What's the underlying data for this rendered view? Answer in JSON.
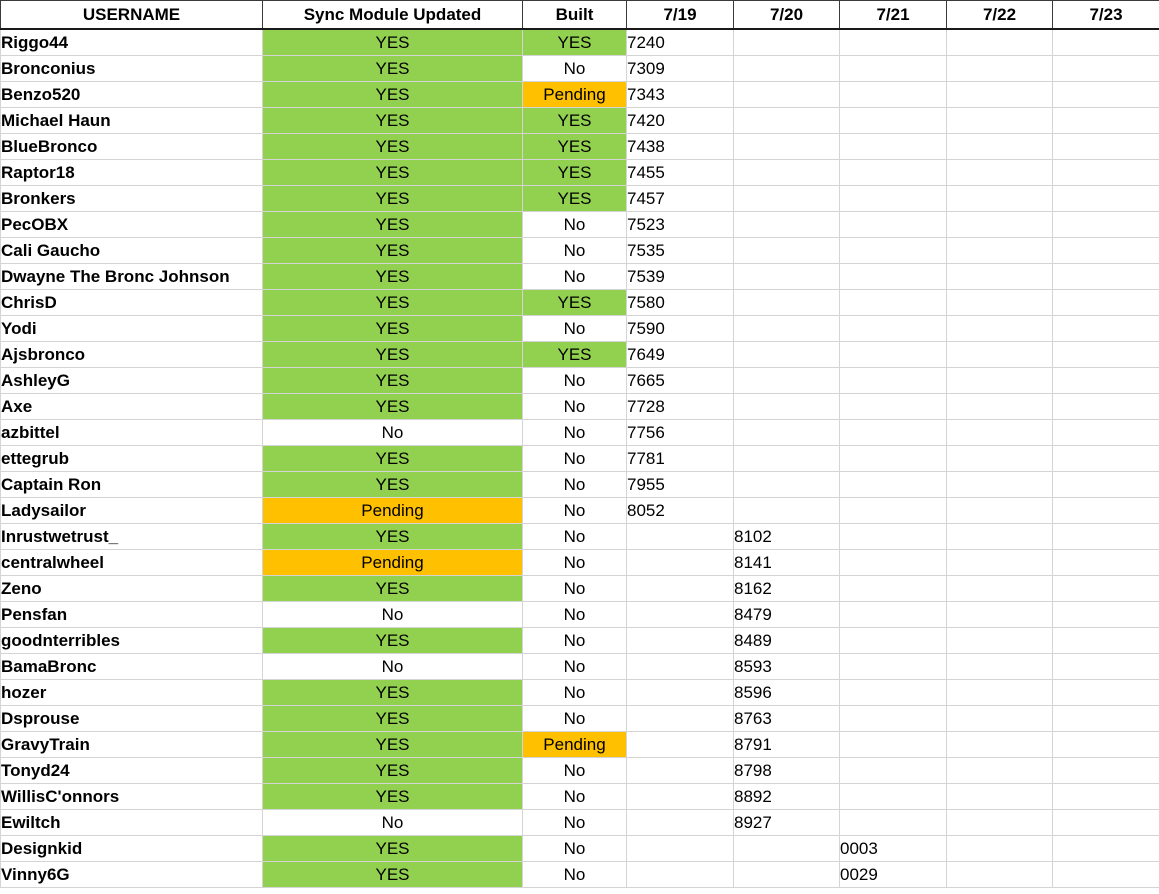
{
  "sheet": {
    "headers": [
      "USERNAME",
      "Sync Module Updated",
      "Built",
      "7/19",
      "7/20",
      "7/21",
      "7/22",
      "7/23"
    ],
    "rows": [
      {
        "user": "Riggo44",
        "sync": "YES",
        "built": "YES",
        "dates": [
          "7240",
          "",
          "",
          "",
          ""
        ]
      },
      {
        "user": "Bronconius",
        "sync": "YES",
        "built": "No",
        "dates": [
          "7309",
          "",
          "",
          "",
          ""
        ]
      },
      {
        "user": "Benzo520",
        "sync": "YES",
        "built": "Pending",
        "dates": [
          "7343",
          "",
          "",
          "",
          ""
        ]
      },
      {
        "user": "Michael Haun",
        "sync": "YES",
        "built": "YES",
        "dates": [
          "7420",
          "",
          "",
          "",
          ""
        ]
      },
      {
        "user": "BlueBronco",
        "sync": "YES",
        "built": "YES",
        "dates": [
          "7438",
          "",
          "",
          "",
          ""
        ]
      },
      {
        "user": "Raptor18",
        "sync": "YES",
        "built": "YES",
        "dates": [
          "7455",
          "",
          "",
          "",
          ""
        ]
      },
      {
        "user": "Bronkers",
        "sync": "YES",
        "built": "YES",
        "dates": [
          "7457",
          "",
          "",
          "",
          ""
        ]
      },
      {
        "user": "PecOBX",
        "sync": "YES",
        "built": "No",
        "dates": [
          "7523",
          "",
          "",
          "",
          ""
        ]
      },
      {
        "user": "Cali Gaucho",
        "sync": "YES",
        "built": "No",
        "dates": [
          "7535",
          "",
          "",
          "",
          ""
        ]
      },
      {
        "user": "Dwayne The Bronc Johnson",
        "sync": "YES",
        "built": "No",
        "dates": [
          "7539",
          "",
          "",
          "",
          ""
        ]
      },
      {
        "user": "ChrisD",
        "sync": "YES",
        "built": "YES",
        "dates": [
          "7580",
          "",
          "",
          "",
          ""
        ]
      },
      {
        "user": "Yodi",
        "sync": "YES",
        "built": "No",
        "dates": [
          "7590",
          "",
          "",
          "",
          ""
        ]
      },
      {
        "user": "Ajsbronco",
        "sync": "YES",
        "built": "YES",
        "dates": [
          "7649",
          "",
          "",
          "",
          ""
        ]
      },
      {
        "user": "AshleyG",
        "sync": "YES",
        "built": "No",
        "dates": [
          "7665",
          "",
          "",
          "",
          ""
        ]
      },
      {
        "user": "Axe",
        "sync": "YES",
        "built": "No",
        "dates": [
          "7728",
          "",
          "",
          "",
          ""
        ]
      },
      {
        "user": "azbittel",
        "sync": "No",
        "built": "No",
        "dates": [
          "7756",
          "",
          "",
          "",
          ""
        ]
      },
      {
        "user": "ettegrub",
        "sync": "YES",
        "built": "No",
        "dates": [
          "7781",
          "",
          "",
          "",
          ""
        ]
      },
      {
        "user": "Captain Ron",
        "sync": "YES",
        "built": "No",
        "dates": [
          "7955",
          "",
          "",
          "",
          ""
        ]
      },
      {
        "user": "Ladysailor",
        "sync": "Pending",
        "built": "No",
        "dates": [
          "8052",
          "",
          "",
          "",
          ""
        ]
      },
      {
        "user": "Inrustwetrust_",
        "sync": "YES",
        "built": "No",
        "dates": [
          "",
          "8102",
          "",
          "",
          ""
        ]
      },
      {
        "user": "centralwheel",
        "sync": "Pending",
        "built": "No",
        "dates": [
          "",
          "8141",
          "",
          "",
          ""
        ]
      },
      {
        "user": "Zeno",
        "sync": "YES",
        "built": "No",
        "dates": [
          "",
          "8162",
          "",
          "",
          ""
        ]
      },
      {
        "user": "Pensfan",
        "sync": "No",
        "built": "No",
        "dates": [
          "",
          "8479",
          "",
          "",
          ""
        ]
      },
      {
        "user": "goodnterribles",
        "sync": "YES",
        "built": "No",
        "dates": [
          "",
          "8489",
          "",
          "",
          ""
        ]
      },
      {
        "user": "BamaBronc",
        "sync": "No",
        "built": "No",
        "dates": [
          "",
          "8593",
          "",
          "",
          ""
        ]
      },
      {
        "user": "hozer",
        "sync": "YES",
        "built": "No",
        "dates": [
          "",
          "8596",
          "",
          "",
          ""
        ]
      },
      {
        "user": "Dsprouse",
        "sync": "YES",
        "built": "No",
        "dates": [
          "",
          "8763",
          "",
          "",
          ""
        ]
      },
      {
        "user": "GravyTrain",
        "sync": "YES",
        "built": "Pending",
        "dates": [
          "",
          "8791",
          "",
          "",
          ""
        ]
      },
      {
        "user": "Tonyd24",
        "sync": "YES",
        "built": "No",
        "dates": [
          "",
          "8798",
          "",
          "",
          ""
        ]
      },
      {
        "user": "WillisC'onnors",
        "sync": "YES",
        "built": "No",
        "dates": [
          "",
          "8892",
          "",
          "",
          ""
        ]
      },
      {
        "user": "Ewiltch",
        "sync": "No",
        "built": "No",
        "dates": [
          "",
          "8927",
          "",
          "",
          ""
        ]
      },
      {
        "user": "Designkid",
        "sync": "YES",
        "built": "No",
        "dates": [
          "",
          "",
          "0003",
          "",
          ""
        ]
      },
      {
        "user": "Vinny6G",
        "sync": "YES",
        "built": "No",
        "dates": [
          "",
          "",
          "0029",
          "",
          ""
        ]
      }
    ]
  },
  "colors": {
    "yes_fill": "#92d050",
    "pending_fill": "#ffc000",
    "no_fill": "#ffffff"
  }
}
